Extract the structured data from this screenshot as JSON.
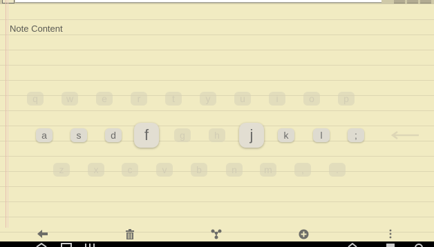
{
  "note": {
    "content_label": "Note Content"
  },
  "keyboard": {
    "row1": [
      "q",
      "w",
      "e",
      "r",
      "t",
      "y",
      "u",
      "i",
      "o",
      "p"
    ],
    "row2": [
      "a",
      "s",
      "d",
      "f",
      "g",
      "h",
      "j",
      "k",
      "l",
      ";"
    ],
    "row3": [
      "z",
      "x",
      "c",
      "v",
      "b",
      "n",
      "m",
      ",",
      "."
    ]
  },
  "toolbar": {
    "icons": [
      "back-arrow-icon",
      "trash-icon",
      "share-icon",
      "add-circle-icon",
      "overflow-menu-icon"
    ]
  },
  "colors": {
    "paper": "#f1ebc2",
    "rule_line": "#ddd6b2",
    "icon_gray": "#6d6d68"
  }
}
